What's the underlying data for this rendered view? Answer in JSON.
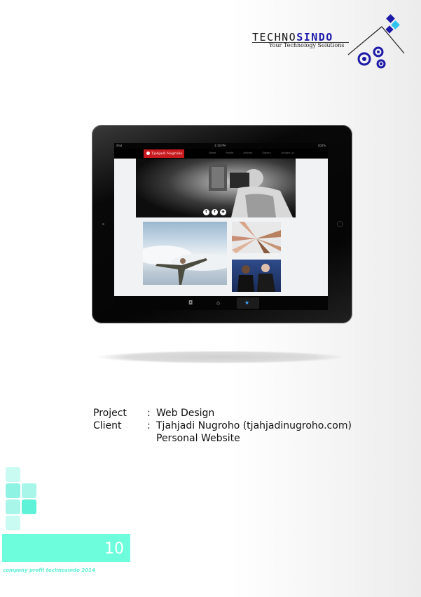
{
  "logo": {
    "word_part1": "TECHNO",
    "word_part2": "SINDO",
    "tagline": "Your Technology Solutions",
    "accent_color": "#1d1aa8",
    "secondary_color": "#2ec4f0"
  },
  "tablet": {
    "status_left": "iPad",
    "status_time": "3:16 PM",
    "status_right": "100%",
    "site_logo": "Tjahjadi Nugroho",
    "nav_links": [
      "Home",
      "Profile",
      "Articles",
      "Gallery",
      "Contact us"
    ],
    "social_icons": [
      "t",
      "f",
      "rss"
    ]
  },
  "project": {
    "label": "Project",
    "value": "Web Design"
  },
  "client": {
    "label": "Client",
    "value": "Tjahjadi Nugroho (tjahjadinugroho.com)",
    "value2": "Personal Website"
  },
  "colon": ":",
  "page_number": "10",
  "footer": "company profil technosindo 2014",
  "colors": {
    "band": "#6dfcdc",
    "square_light": "#c9fbf3",
    "square_mid": "#a8f6ea",
    "square_strong": "#5ef2d8"
  }
}
